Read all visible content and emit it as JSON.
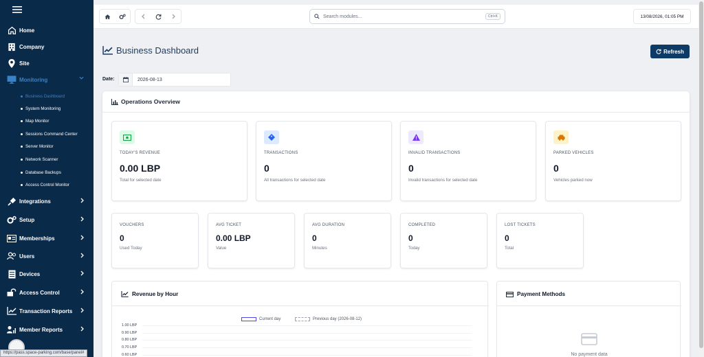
{
  "sidebar": {
    "items": [
      {
        "label": "Home",
        "icon": "home-icon"
      },
      {
        "label": "Company",
        "icon": "building-icon"
      },
      {
        "label": "Site",
        "icon": "map-pin-icon"
      },
      {
        "label": "Monitoring",
        "icon": "monitor-icon",
        "active": true
      },
      {
        "label": "Integrations",
        "icon": "plug-icon"
      },
      {
        "label": "Setup",
        "icon": "gears-icon"
      },
      {
        "label": "Memberships",
        "icon": "id-card-icon"
      },
      {
        "label": "Users",
        "icon": "users-icon"
      },
      {
        "label": "Devices",
        "icon": "server-icon"
      },
      {
        "label": "Access Control",
        "icon": "unlock-icon"
      },
      {
        "label": "Transaction Reports",
        "icon": "chart-line-icon"
      },
      {
        "label": "Member Reports",
        "icon": "user-chart-icon"
      }
    ],
    "monitoring_sub": [
      {
        "label": "Business Dashboard",
        "active": true
      },
      {
        "label": "System Monitoring"
      },
      {
        "label": "Map Monitor"
      },
      {
        "label": "Sessions Command Center"
      },
      {
        "label": "Server Monitor"
      },
      {
        "label": "Network Scanner"
      },
      {
        "label": "Database Backups"
      },
      {
        "label": "Access Control Monitor"
      }
    ]
  },
  "topbar": {
    "search_placeholder": "Search modules...",
    "shortcut": "Ctrl+K",
    "datetime": "13/08/2026, 01:05 PM"
  },
  "page": {
    "title": "Business Dashboard",
    "refresh_label": "Refresh",
    "date_label": "Date:",
    "date_value": "2026-08-13"
  },
  "overview": {
    "title": "Operations Overview",
    "cards": [
      {
        "label": "TODAY'S REVENUE",
        "value": "0.00 LBP",
        "sub": "Total for selected date",
        "icon": "money-icon",
        "color": "#16a34a",
        "bg": "#dcfce7"
      },
      {
        "label": "TRANSACTIONS",
        "value": "0",
        "sub": "All transactions for selected date",
        "icon": "tag-icon",
        "color": "#2563eb",
        "bg": "#dbeafe"
      },
      {
        "label": "INVALID TRANSACTIONS",
        "value": "0",
        "sub": "Invalid transactions for selected date",
        "icon": "warning-icon",
        "color": "#7c3aed",
        "bg": "#ede9fe"
      },
      {
        "label": "PARKED VEHICLES",
        "value": "0",
        "sub": "Vehicles parked now",
        "icon": "car-icon",
        "color": "#d97706",
        "bg": "#fef3c7"
      }
    ],
    "small_cards": [
      {
        "label": "VOUCHERS",
        "value": "0",
        "sub": "Used Today"
      },
      {
        "label": "AVG TICKET",
        "value": "0.00 LBP",
        "sub": "Value"
      },
      {
        "label": "AVG DURATION",
        "value": "0",
        "sub": "Minutes"
      },
      {
        "label": "COMPLETED",
        "value": "0",
        "sub": "Today"
      },
      {
        "label": "LOST TICKETS",
        "value": "0",
        "sub": "Total"
      }
    ]
  },
  "revenue_chart": {
    "title": "Revenue by Hour",
    "legend_current": "Current day",
    "legend_previous": "Previous day (2026-08-12)"
  },
  "chart_data": {
    "type": "line",
    "title": "Revenue by Hour",
    "series": [
      {
        "name": "Current day",
        "values": []
      },
      {
        "name": "Previous day (2026-08-12)",
        "values": []
      }
    ],
    "y_ticks": [
      "1.00 LBP",
      "0.90 LBP",
      "0.80 LBP",
      "0.70 LBP",
      "0.60 LBP"
    ],
    "ylim": [
      0.6,
      1.0
    ],
    "grid": true,
    "legend": "top-center"
  },
  "payment": {
    "title": "Payment Methods",
    "empty_text": "No payment data"
  },
  "statusbar": {
    "url": "https://pass.space-parking.com/base/panel#"
  }
}
